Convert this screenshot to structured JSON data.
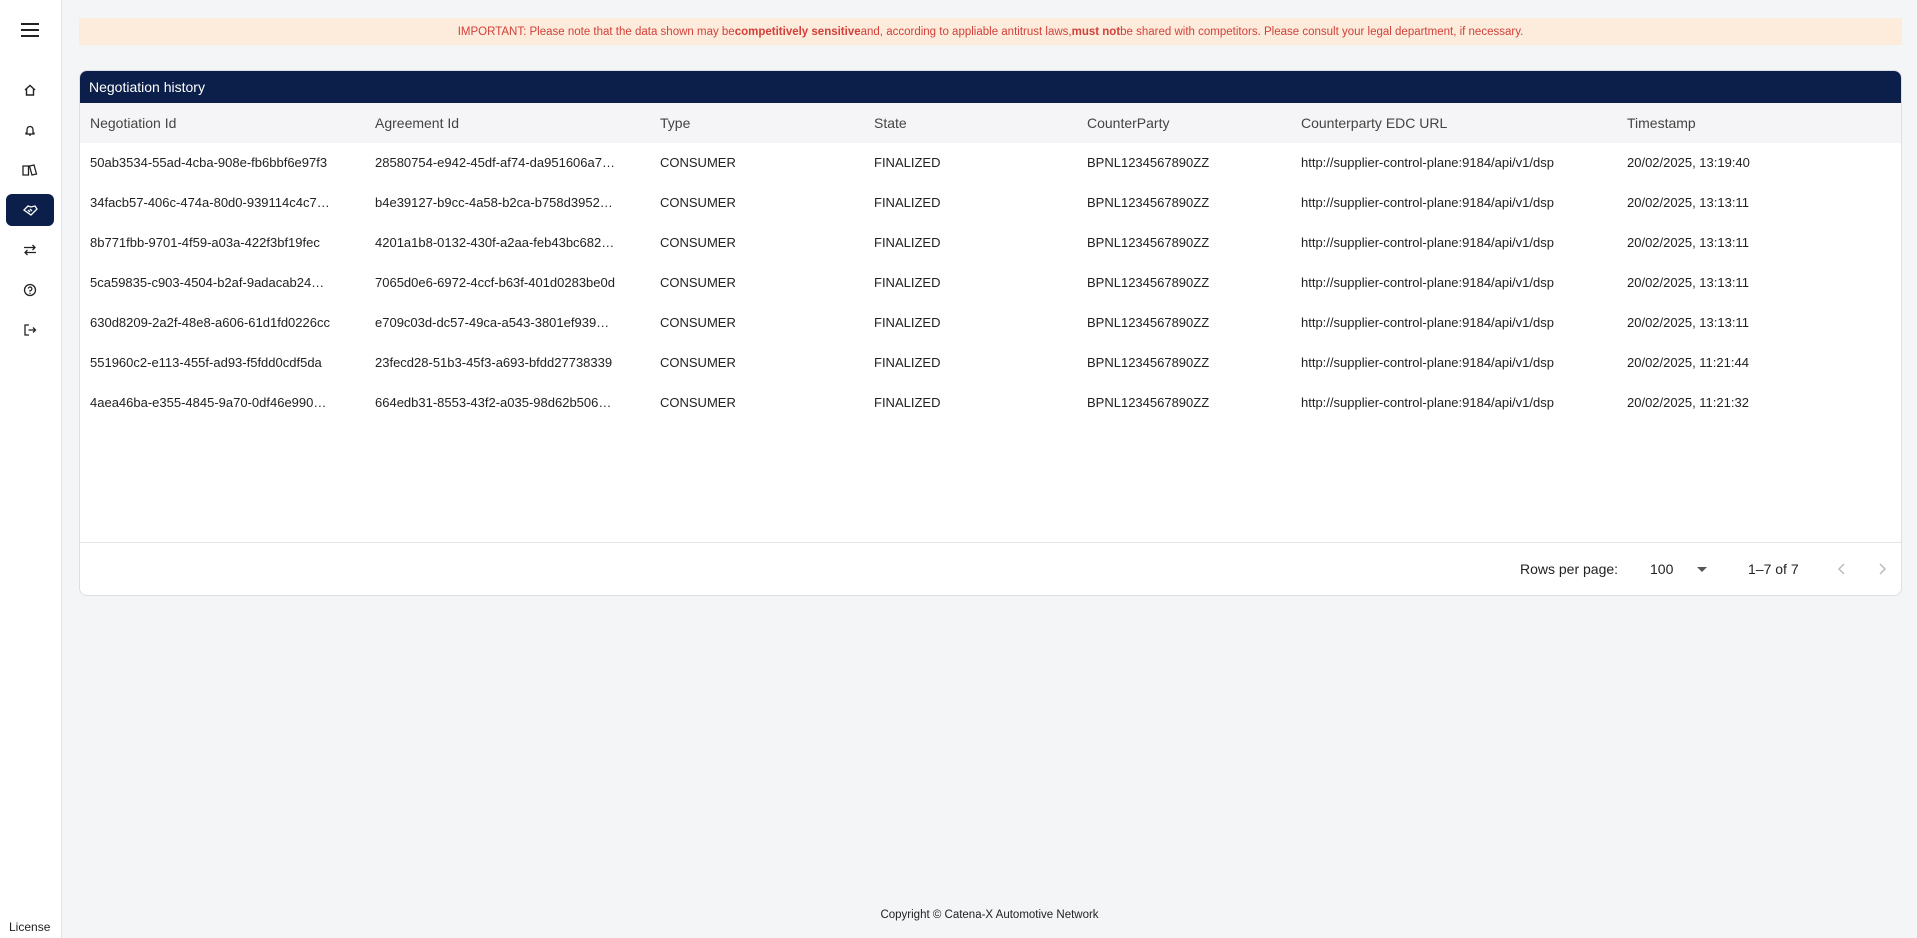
{
  "sidebar": {
    "items": [
      {
        "icon": "home-icon"
      },
      {
        "icon": "bell-icon"
      },
      {
        "icon": "book-icon"
      },
      {
        "icon": "handshake-icon",
        "active": true
      },
      {
        "icon": "transfer-icon"
      },
      {
        "icon": "help-icon"
      },
      {
        "icon": "logout-icon"
      }
    ],
    "license_label": "License"
  },
  "banner": {
    "part1": "IMPORTANT: Please note that the data shown may be ",
    "bold1": "competitively sensitive",
    "part2": " and, according to appliable antitrust laws, ",
    "bold2": "must not",
    "part3": " be shared with competitors. Please consult your legal department, if necessary."
  },
  "card": {
    "title": "Negotiation history",
    "columns": [
      "Negotiation Id",
      "Agreement Id",
      "Type",
      "State",
      "CounterParty",
      "Counterparty EDC URL",
      "Timestamp"
    ],
    "rows": [
      [
        "50ab3534-55ad-4cba-908e-fb6bbf6e97f3",
        "28580754-e942-45df-af74-da951606a7…",
        "CONSUMER",
        "FINALIZED",
        "BPNL1234567890ZZ",
        "http://supplier-control-plane:9184/api/v1/dsp",
        "20/02/2025, 13:19:40"
      ],
      [
        "34facb57-406c-474a-80d0-939114c4c7…",
        "b4e39127-b9cc-4a58-b2ca-b758d3952…",
        "CONSUMER",
        "FINALIZED",
        "BPNL1234567890ZZ",
        "http://supplier-control-plane:9184/api/v1/dsp",
        "20/02/2025, 13:13:11"
      ],
      [
        "8b771fbb-9701-4f59-a03a-422f3bf19fec",
        "4201a1b8-0132-430f-a2aa-feb43bc682…",
        "CONSUMER",
        "FINALIZED",
        "BPNL1234567890ZZ",
        "http://supplier-control-plane:9184/api/v1/dsp",
        "20/02/2025, 13:13:11"
      ],
      [
        "5ca59835-c903-4504-b2af-9adacab24…",
        "7065d0e6-6972-4ccf-b63f-401d0283be0d",
        "CONSUMER",
        "FINALIZED",
        "BPNL1234567890ZZ",
        "http://supplier-control-plane:9184/api/v1/dsp",
        "20/02/2025, 13:13:11"
      ],
      [
        "630d8209-2a2f-48e8-a606-61d1fd0226cc",
        "e709c03d-dc57-49ca-a543-3801ef939…",
        "CONSUMER",
        "FINALIZED",
        "BPNL1234567890ZZ",
        "http://supplier-control-plane:9184/api/v1/dsp",
        "20/02/2025, 13:13:11"
      ],
      [
        "551960c2-e113-455f-ad93-f5fdd0cdf5da",
        "23fecd28-51b3-45f3-a693-bfdd27738339",
        "CONSUMER",
        "FINALIZED",
        "BPNL1234567890ZZ",
        "http://supplier-control-plane:9184/api/v1/dsp",
        "20/02/2025, 11:21:44"
      ],
      [
        "4aea46ba-e355-4845-9a70-0df46e990…",
        "664edb31-8553-43f2-a035-98d62b506…",
        "CONSUMER",
        "FINALIZED",
        "BPNL1234567890ZZ",
        "http://supplier-control-plane:9184/api/v1/dsp",
        "20/02/2025, 11:21:32"
      ]
    ],
    "pagination": {
      "rows_per_page_label": "Rows per page:",
      "rows_per_page_value": "100",
      "range": "1–7 of 7"
    }
  },
  "footer": {
    "copyright": "Copyright © Catena-X Automotive Network"
  },
  "colors": {
    "accent": "#0b1f4a",
    "banner_bg": "#fdebdc",
    "banner_text": "#d2413a"
  }
}
